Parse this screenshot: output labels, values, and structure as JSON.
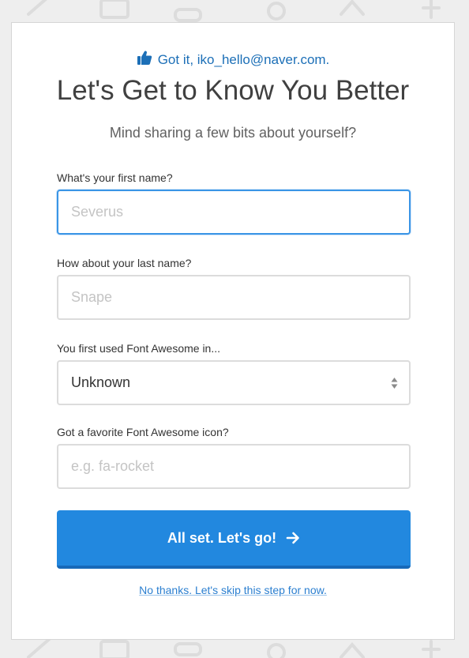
{
  "header": {
    "confirmation_text": "Got it, iko_hello@naver.com.",
    "title": "Let's Get to Know You Better",
    "subtitle": "Mind sharing a few bits about yourself?"
  },
  "form": {
    "first_name": {
      "label": "What's your first name?",
      "placeholder": "Severus",
      "value": ""
    },
    "last_name": {
      "label": "How about your last name?",
      "placeholder": "Snape",
      "value": ""
    },
    "first_used": {
      "label": "You first used Font Awesome in...",
      "selected": "Unknown"
    },
    "favorite_icon": {
      "label": "Got a favorite Font Awesome icon?",
      "placeholder": "e.g. fa-rocket",
      "value": ""
    }
  },
  "actions": {
    "submit_label": "All set. Let's go!",
    "skip_label": "No thanks. Let's skip this step for now."
  },
  "icons": {
    "confirmation": "thumbs-up-icon",
    "submit": "arrow-right-icon",
    "select": "sort-arrows-icon"
  },
  "colors": {
    "accent": "#2288df",
    "link": "#1c6fb7",
    "focus_border": "#3a95e6",
    "background": "#eeeeee"
  }
}
